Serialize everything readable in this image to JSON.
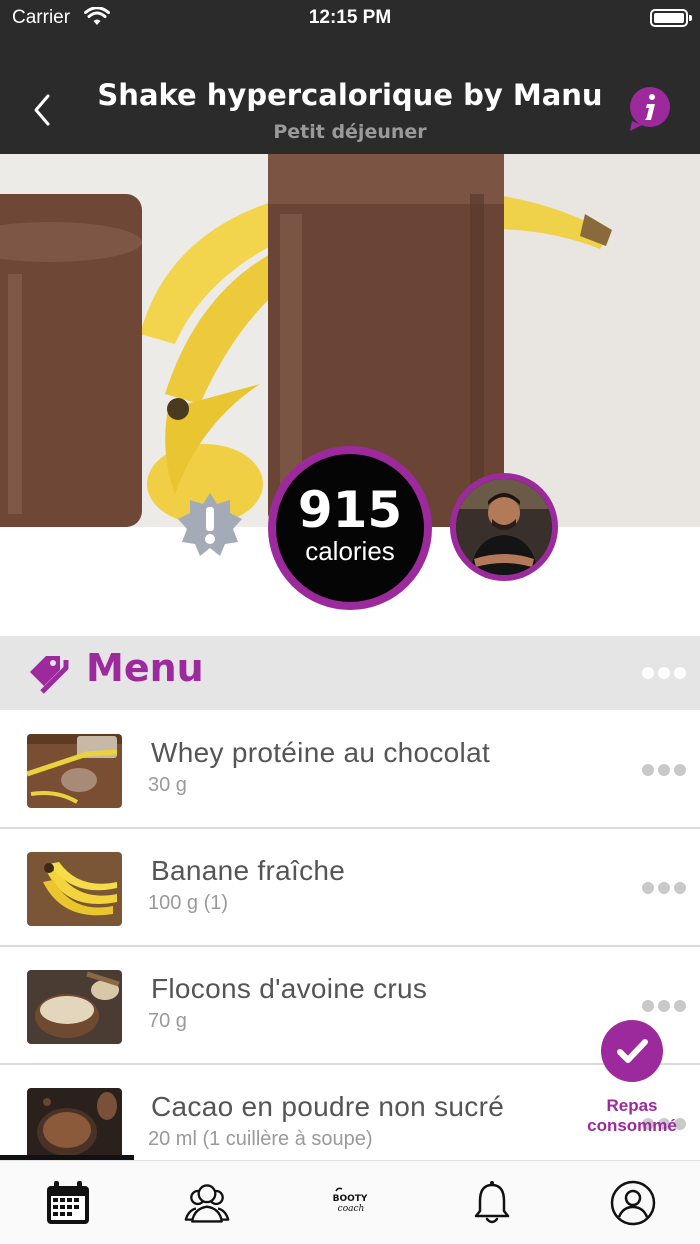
{
  "status_bar": {
    "carrier": "Carrier",
    "time": "12:15 PM"
  },
  "nav": {
    "title": "Shake hypercalorique by Manu",
    "subtitle": "Petit déjeuner"
  },
  "nutrition": {
    "calories_value": "915",
    "calories_label": "calories"
  },
  "menu": {
    "title": "Menu"
  },
  "foods": [
    {
      "name": "Whey protéine au chocolat",
      "quantity": "30 g"
    },
    {
      "name": "Banane fraîche",
      "quantity": "100 g (1)"
    },
    {
      "name": "Flocons d'avoine crus",
      "quantity": "70 g"
    },
    {
      "name": "Cacao en poudre non sucré",
      "quantity": "20 ml (1 cuillère à soupe)"
    }
  ],
  "actions": {
    "consumed_line1": "Repas",
    "consumed_line2": "consommé"
  },
  "tabbar_logo_text": "BOOTY coach",
  "colors": {
    "accent": "#9c2a9c",
    "nav_background": "#2b2b2b",
    "header_band": "#e5e5e5"
  },
  "icons": [
    "wifi-icon",
    "battery-icon",
    "back-chevron-icon",
    "info-icon",
    "alert-badge-icon",
    "tag-icon",
    "more-dots-icon",
    "checkmark-icon",
    "calendar-icon",
    "community-icon",
    "booty-coach-logo",
    "bell-icon",
    "profile-icon"
  ]
}
